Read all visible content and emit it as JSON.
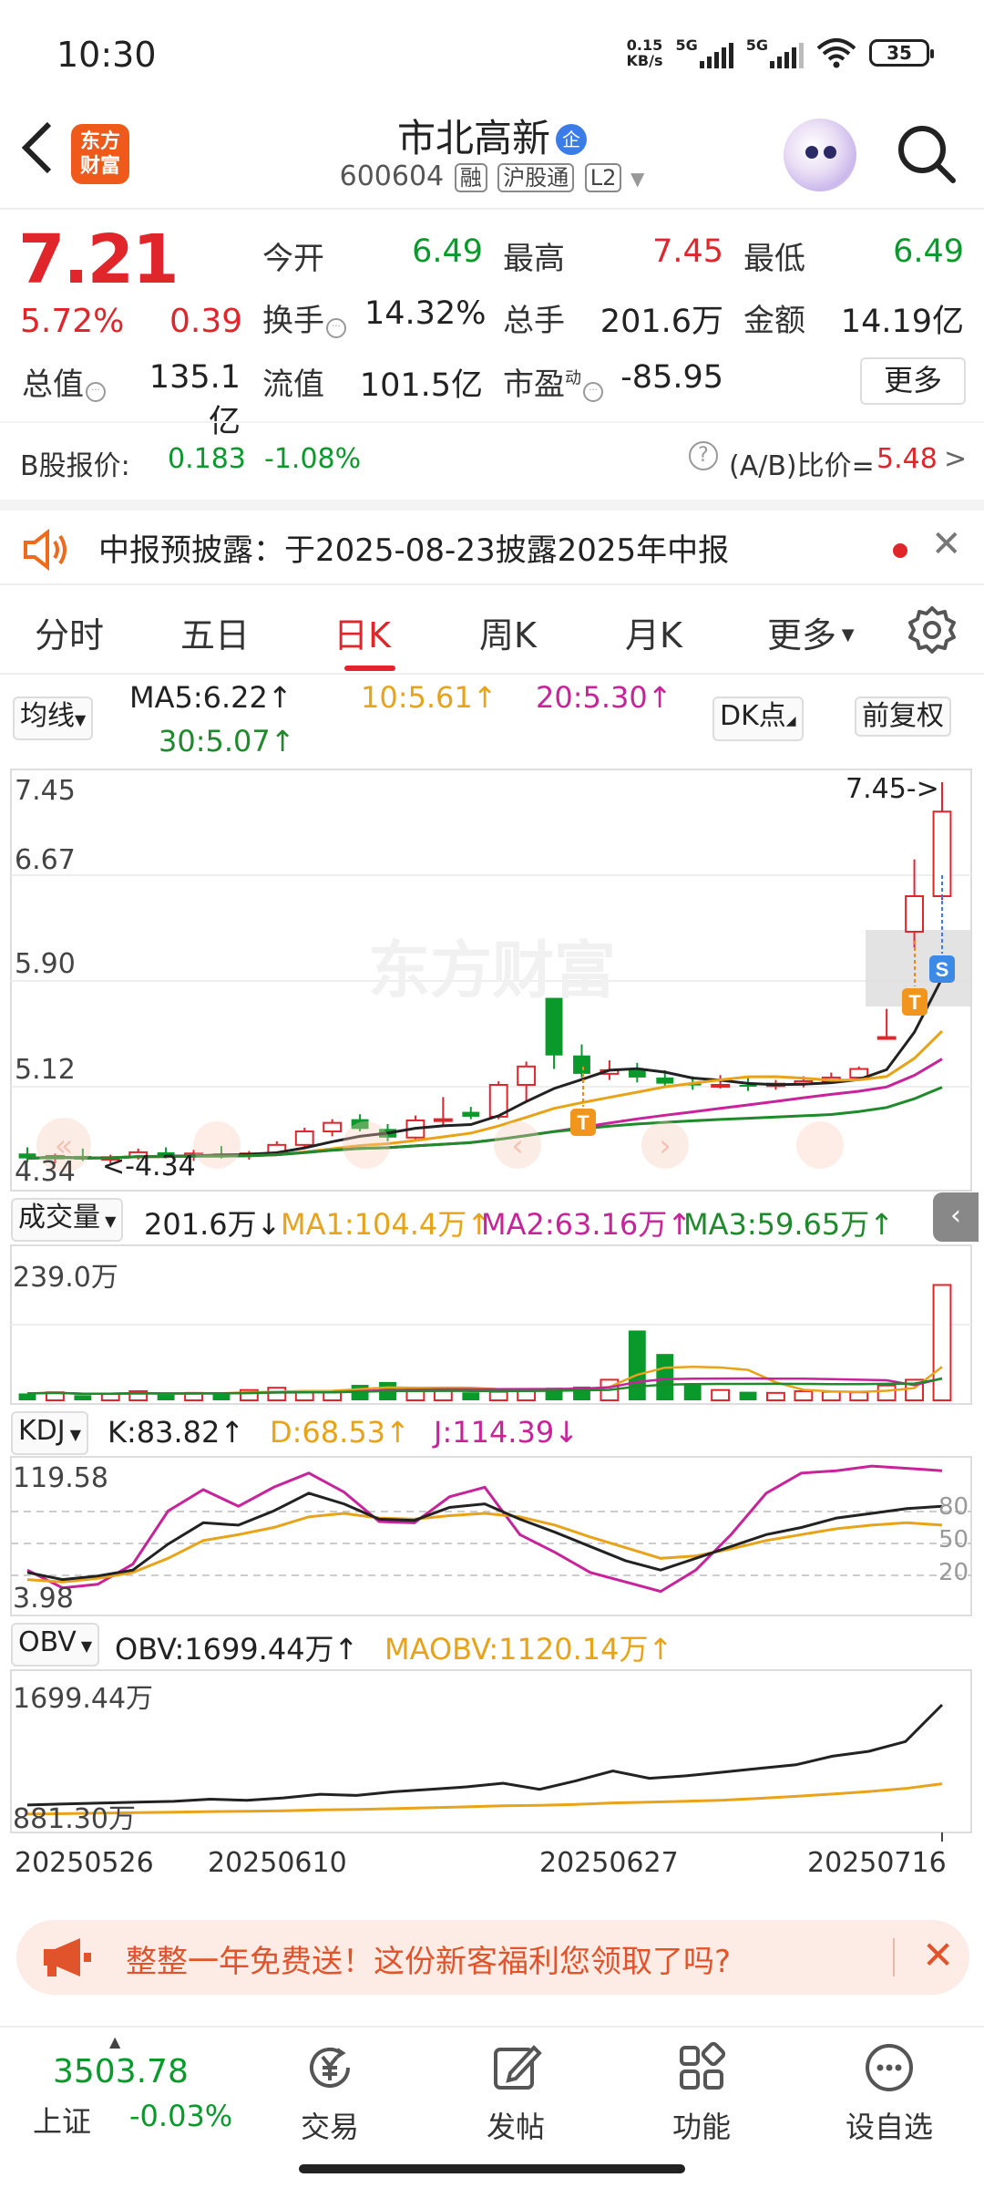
{
  "status_bar": {
    "time": "10:30",
    "net_speed_value": "0.15",
    "net_speed_unit": "KB/s",
    "sig1": "5G",
    "sig2": "5G",
    "battery": "35"
  },
  "header": {
    "logo_line1": "东方",
    "logo_line2": "财富",
    "stock_name": "市北高新",
    "badge": "企",
    "code": "600604",
    "tag_margin": "融",
    "tag_connect": "沪股通",
    "tag_level": "L2"
  },
  "quote": {
    "price": "7.21",
    "change_pct": "5.72%",
    "change_amt": "0.39",
    "open_label": "今开",
    "open": "6.49",
    "high_label": "最高",
    "high": "7.45",
    "low_label": "最低",
    "low": "6.49",
    "turnover_label": "换手",
    "turnover": "14.32%",
    "volume_label": "总手",
    "volume": "201.6万",
    "amount_label": "金额",
    "amount": "14.19亿",
    "mktcap_label": "总值",
    "mktcap": "135.1亿",
    "float_label": "流值",
    "float": "101.5亿",
    "pe_label": "市盈",
    "pe_sup": "动",
    "pe": "-85.95",
    "more": "更多"
  },
  "b_share": {
    "label": "B股报价:",
    "price": "0.183",
    "pct": "-1.08%",
    "ratio_label": "(A/B)比价=",
    "ratio": "5.48",
    "arrow": ">"
  },
  "notice": {
    "text": "中报预披露：于2025-08-23披露2025年中报"
  },
  "tabs": [
    "分时",
    "五日",
    "日K",
    "周K",
    "月K",
    "更多"
  ],
  "ma": {
    "selector": "均线",
    "ma5": "MA5:6.22↑",
    "ma10": "10:5.61↑",
    "ma20": "20:5.30↑",
    "ma30": "30:5.07↑",
    "dk": "DK点",
    "fq": "前复权"
  },
  "kline": {
    "y_labels": [
      "7.45",
      "6.67",
      "5.90",
      "5.12"
    ],
    "low_label": "4.34",
    "low_marker": "<-4.34",
    "high_marker": "7.45->",
    "watermark": "东方财富"
  },
  "volume": {
    "selector": "成交量",
    "current": "201.6万↓",
    "ma1": "MA1:104.4万↑",
    "ma2": "MA2:63.16万↑",
    "ma3": "MA3:59.65万↑",
    "y_max": "239.0万"
  },
  "kdj": {
    "selector": "KDJ",
    "k": "K:83.82↑",
    "d": "D:68.53↑",
    "j": "J:114.39↓",
    "y_max": "119.58",
    "y_min": "3.98",
    "lv80": "80",
    "lv50": "50",
    "lv20": "20"
  },
  "obv": {
    "selector": "OBV",
    "obv": "OBV:1699.44万↑",
    "maobv": "MAOBV:1120.14万↑",
    "y_max": "1699.44万",
    "y_min": "881.30万"
  },
  "dates": [
    "20250526",
    "20250610",
    "20250627",
    "20250716"
  ],
  "ad": {
    "text": "整整一年免费送！这份新客福利您领取了吗?"
  },
  "bottom": {
    "index_value": "3503.78",
    "index_name": "上证",
    "index_change": "-0.03%",
    "items": [
      "交易",
      "发帖",
      "功能",
      "设自选"
    ]
  },
  "colors": {
    "red": "#e0252b",
    "green": "#0a9a2c",
    "ma5": "#222222",
    "ma10": "#e8a319",
    "ma20": "#c8239a",
    "ma30": "#1f8a2b"
  },
  "chart_data": {
    "type": "candlestick",
    "dates_shown": [
      "20250526",
      "20250610",
      "20250627",
      "20250716"
    ],
    "ylim": [
      4.34,
      7.45
    ],
    "candles": [
      {
        "o": 4.42,
        "h": 4.47,
        "l": 4.35,
        "c": 4.38
      },
      {
        "o": 4.38,
        "h": 4.42,
        "l": 4.34,
        "c": 4.4
      },
      {
        "o": 4.4,
        "h": 4.46,
        "l": 4.36,
        "c": 4.37
      },
      {
        "o": 4.37,
        "h": 4.41,
        "l": 4.34,
        "c": 4.39
      },
      {
        "o": 4.39,
        "h": 4.46,
        "l": 4.37,
        "c": 4.43
      },
      {
        "o": 4.43,
        "h": 4.47,
        "l": 4.38,
        "c": 4.4
      },
      {
        "o": 4.4,
        "h": 4.45,
        "l": 4.36,
        "c": 4.42
      },
      {
        "o": 4.42,
        "h": 4.48,
        "l": 4.38,
        "c": 4.4
      },
      {
        "o": 4.4,
        "h": 4.44,
        "l": 4.37,
        "c": 4.42
      },
      {
        "o": 4.42,
        "h": 4.52,
        "l": 4.4,
        "c": 4.49
      },
      {
        "o": 4.49,
        "h": 4.63,
        "l": 4.46,
        "c": 4.6
      },
      {
        "o": 4.6,
        "h": 4.7,
        "l": 4.56,
        "c": 4.67
      },
      {
        "o": 4.7,
        "h": 4.74,
        "l": 4.6,
        "c": 4.62
      },
      {
        "o": 4.62,
        "h": 4.66,
        "l": 4.52,
        "c": 4.55
      },
      {
        "o": 4.55,
        "h": 4.73,
        "l": 4.53,
        "c": 4.69
      },
      {
        "o": 4.69,
        "h": 4.88,
        "l": 4.64,
        "c": 4.7
      },
      {
        "o": 4.76,
        "h": 4.8,
        "l": 4.7,
        "c": 4.72
      },
      {
        "o": 4.72,
        "h": 5.01,
        "l": 4.7,
        "c": 4.98
      },
      {
        "o": 4.98,
        "h": 5.17,
        "l": 4.85,
        "c": 5.13
      },
      {
        "o": 5.69,
        "h": 5.69,
        "l": 5.11,
        "c": 5.22
      },
      {
        "o": 5.22,
        "h": 5.31,
        "l": 5.04,
        "c": 5.07
      },
      {
        "o": 5.07,
        "h": 5.18,
        "l": 5.02,
        "c": 5.1
      },
      {
        "o": 5.1,
        "h": 5.16,
        "l": 5.0,
        "c": 5.04
      },
      {
        "o": 5.04,
        "h": 5.1,
        "l": 4.96,
        "c": 4.99
      },
      {
        "o": 4.99,
        "h": 5.05,
        "l": 4.94,
        "c": 4.98
      },
      {
        "o": 4.98,
        "h": 5.06,
        "l": 4.95,
        "c": 4.98
      },
      {
        "o": 4.98,
        "h": 5.04,
        "l": 4.93,
        "c": 4.97
      },
      {
        "o": 4.97,
        "h": 5.02,
        "l": 4.94,
        "c": 4.99
      },
      {
        "o": 4.99,
        "h": 5.05,
        "l": 4.96,
        "c": 5.01
      },
      {
        "o": 5.01,
        "h": 5.08,
        "l": 4.99,
        "c": 5.04
      },
      {
        "o": 5.04,
        "h": 5.13,
        "l": 5.02,
        "c": 5.11
      },
      {
        "o": 5.37,
        "h": 5.6,
        "l": 5.37,
        "c": 5.37
      },
      {
        "o": 6.23,
        "h": 6.82,
        "l": 6.1,
        "c": 6.52
      },
      {
        "o": 6.52,
        "h": 7.45,
        "l": 6.49,
        "c": 7.21
      }
    ],
    "volume": [
      12,
      14,
      9,
      11,
      16,
      10,
      13,
      12,
      18,
      22,
      16,
      15,
      27,
      32,
      20,
      17,
      14,
      15,
      19,
      22,
      24,
      36,
      122,
      81,
      30,
      18,
      15,
      13,
      16,
      15,
      14,
      26,
      36,
      201.6
    ],
    "kdj": {
      "k": [
        28,
        22,
        25,
        30,
        52,
        70,
        68,
        80,
        95,
        86,
        73,
        72,
        83,
        86,
        73,
        62,
        50,
        38,
        30,
        40,
        50,
        60,
        66,
        74,
        78,
        82,
        84
      ],
      "d": [
        22,
        20,
        23,
        28,
        40,
        55,
        60,
        66,
        75,
        78,
        74,
        73,
        76,
        78,
        75,
        68,
        58,
        49,
        40,
        42,
        48,
        55,
        60,
        65,
        68,
        70,
        68
      ],
      "j": [
        30,
        15,
        18,
        35,
        80,
        98,
        84,
        100,
        112,
        96,
        71,
        70,
        92,
        100,
        60,
        45,
        28,
        20,
        12,
        30,
        60,
        95,
        112,
        114,
        118,
        116,
        114
      ]
    },
    "obv": [
      882,
      890,
      898,
      905,
      912,
      930,
      920,
      940,
      970,
      960,
      990,
      1010,
      1030,
      1060,
      1010,
      1080,
      1160,
      1100,
      1120,
      1150,
      1180,
      1210,
      1280,
      1320,
      1400,
      1699.44
    ]
  }
}
